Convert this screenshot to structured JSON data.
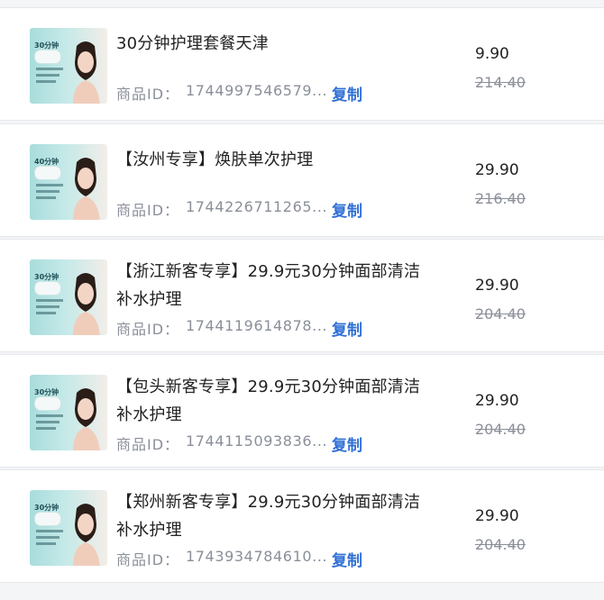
{
  "items": [
    {
      "title_line1": "30分钟护理套餐天津",
      "title_line2": "",
      "id_label": "商品ID：",
      "id_value": "1744997546579...",
      "copy_label": "复制",
      "price": "9.90",
      "original_price": "214.40",
      "thumb_text": "30分钟"
    },
    {
      "title_line1": "【汝州专享】焕肤单次护理",
      "title_line2": "",
      "id_label": "商品ID：",
      "id_value": "1744226711265...",
      "copy_label": "复制",
      "price": "29.90",
      "original_price": "216.40",
      "thumb_text": "40分钟"
    },
    {
      "title_line1": "【浙江新客专享】29.9元30分钟面部清洁",
      "title_line2": "补水护理",
      "id_label": "商品ID：",
      "id_value": "1744119614878...",
      "copy_label": "复制",
      "price": "29.90",
      "original_price": "204.40",
      "thumb_text": "30分钟"
    },
    {
      "title_line1": "【包头新客专享】29.9元30分钟面部清洁",
      "title_line2": "补水护理",
      "id_label": "商品ID：",
      "id_value": "1744115093836...",
      "copy_label": "复制",
      "price": "29.90",
      "original_price": "204.40",
      "thumb_text": "30分钟"
    },
    {
      "title_line1": "【郑州新客专享】29.9元30分钟面部清洁",
      "title_line2": "补水护理",
      "id_label": "商品ID：",
      "id_value": "1743934784610...",
      "copy_label": "复制",
      "price": "29.90",
      "original_price": "204.40",
      "thumb_text": "30分钟"
    }
  ]
}
